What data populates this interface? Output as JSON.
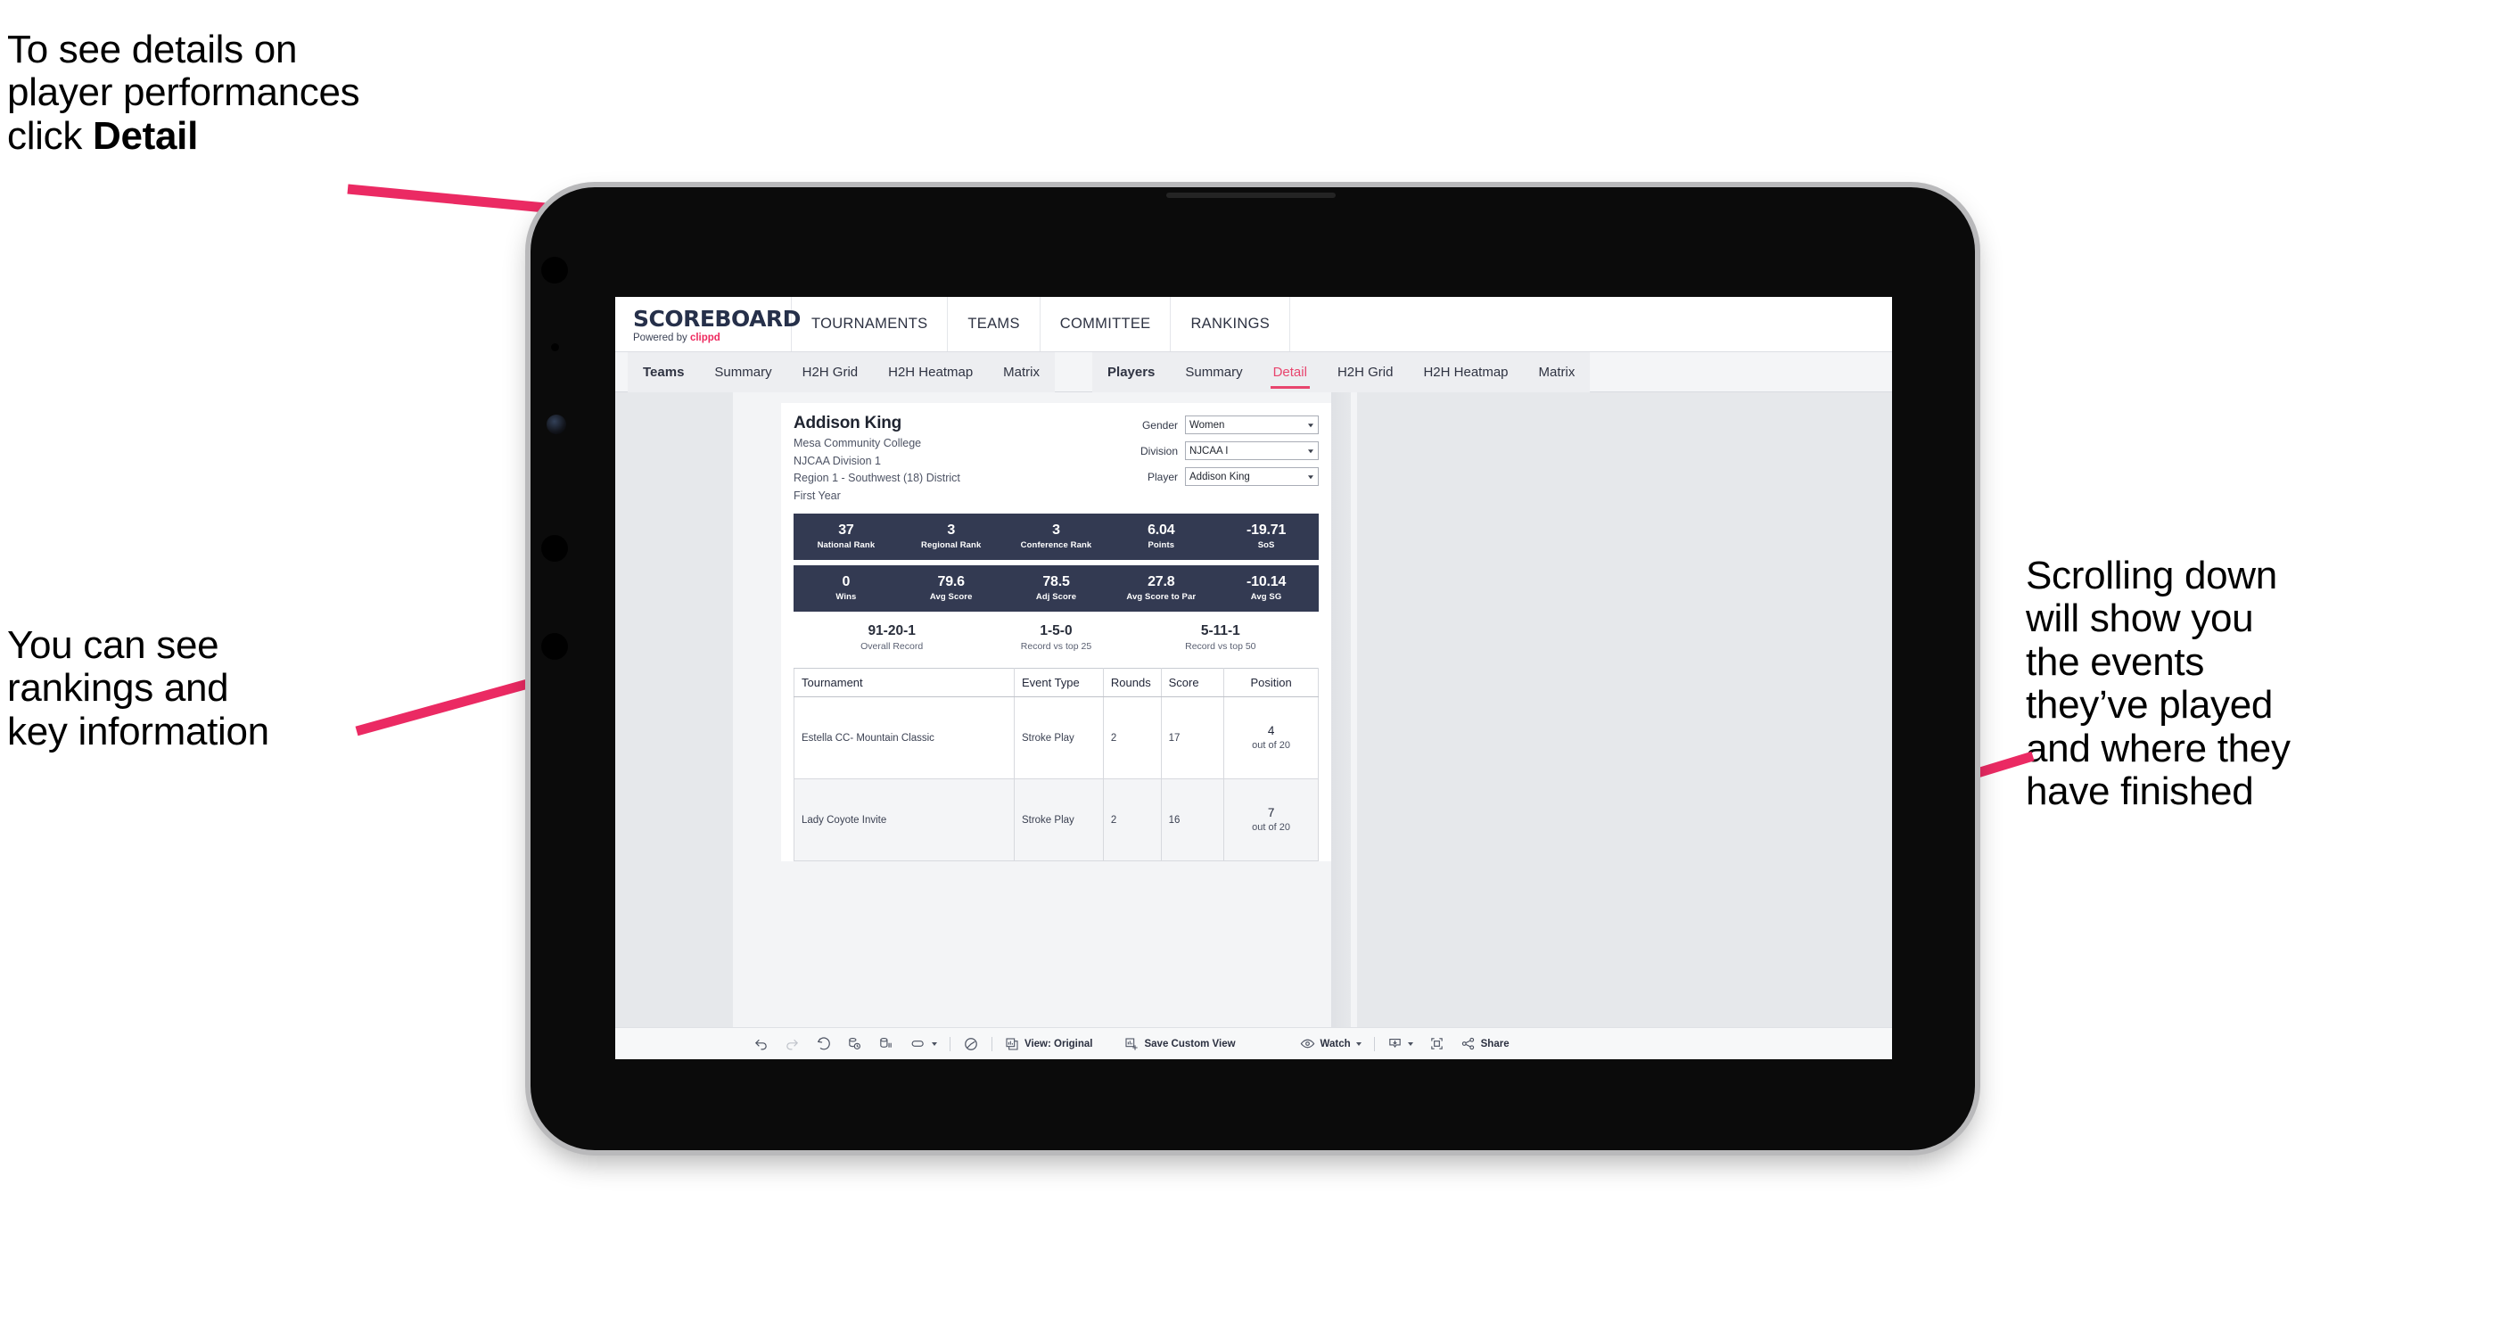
{
  "annotations": {
    "top_left": "To see details on\nplayer performances\nclick ",
    "top_left_bold": "Detail",
    "mid_left": "You can see\nrankings and\nkey information",
    "right": "Scrolling down\nwill show you\nthe events\nthey’ve played\nand where they\nhave finished"
  },
  "colors": {
    "accent_pink": "#e8456e",
    "arrow_pink": "#eb2a63",
    "kpi_navy": "#333a52"
  },
  "brand": {
    "logo_word": "SCOREBOARD",
    "logo_sub_prefix": "Powered by ",
    "logo_sub_brand": "clippd"
  },
  "top_nav": [
    {
      "label": "TOURNAMENTS"
    },
    {
      "label": "TEAMS"
    },
    {
      "label": "COMMITTEE"
    },
    {
      "label": "RANKINGS"
    }
  ],
  "tab_groups": [
    {
      "name": "teams-group",
      "tabs": [
        {
          "label": "Teams",
          "strong": true,
          "active": false
        },
        {
          "label": "Summary",
          "strong": false,
          "active": false
        },
        {
          "label": "H2H Grid",
          "strong": false,
          "active": false
        },
        {
          "label": "H2H Heatmap",
          "strong": false,
          "active": false
        },
        {
          "label": "Matrix",
          "strong": false,
          "active": false
        }
      ]
    },
    {
      "name": "players-group",
      "tabs": [
        {
          "label": "Players",
          "strong": true,
          "active": false
        },
        {
          "label": "Summary",
          "strong": false,
          "active": false
        },
        {
          "label": "Detail",
          "strong": false,
          "active": true
        },
        {
          "label": "H2H Grid",
          "strong": false,
          "active": false
        },
        {
          "label": "H2H Heatmap",
          "strong": false,
          "active": false
        },
        {
          "label": "Matrix",
          "strong": false,
          "active": false
        }
      ]
    }
  ],
  "player": {
    "name": "Addison King",
    "school": "Mesa Community College",
    "division": "NJCAA Division 1",
    "region": "Region 1 - Southwest (18) District",
    "class_year": "First Year"
  },
  "filters": [
    {
      "label": "Gender",
      "value": "Women"
    },
    {
      "label": "Division",
      "value": "NJCAA I"
    },
    {
      "label": "Player",
      "value": "Addison King"
    }
  ],
  "kpi_row_1": [
    {
      "value": "37",
      "label": "National Rank"
    },
    {
      "value": "3",
      "label": "Regional Rank"
    },
    {
      "value": "3",
      "label": "Conference Rank"
    },
    {
      "value": "6.04",
      "label": "Points"
    },
    {
      "value": "-19.71",
      "label": "SoS"
    }
  ],
  "kpi_row_2": [
    {
      "value": "0",
      "label": "Wins"
    },
    {
      "value": "79.6",
      "label": "Avg Score"
    },
    {
      "value": "78.5",
      "label": "Adj Score"
    },
    {
      "value": "27.8",
      "label": "Avg Score to Par"
    },
    {
      "value": "-10.14",
      "label": "Avg SG"
    }
  ],
  "records": [
    {
      "value": "91-20-1",
      "label": "Overall Record"
    },
    {
      "value": "1-5-0",
      "label": "Record vs top 25"
    },
    {
      "value": "5-11-1",
      "label": "Record vs top 50"
    }
  ],
  "events_table": {
    "columns": [
      "Tournament",
      "Event Type",
      "Rounds",
      "Score",
      "Position"
    ],
    "rows": [
      {
        "tournament": "Estella CC- Mountain Classic",
        "event_type": "Stroke Play",
        "rounds": "2",
        "score": "17",
        "position_num": "4",
        "position_out": "out of 20"
      },
      {
        "tournament": "Lady Coyote Invite",
        "event_type": "Stroke Play",
        "rounds": "2",
        "score": "16",
        "position_num": "7",
        "position_out": "out of 20"
      }
    ]
  },
  "toolbar": {
    "icons": [
      "undo-icon",
      "redo-icon",
      "revert-icon",
      "refresh-data-icon",
      "pause-updates-icon",
      "pill-icon",
      "pill-dropdown-icon",
      "presentation-icon"
    ],
    "view_original_label": "View: Original",
    "save_custom_view_label": "Save Custom View",
    "watch_label": "Watch",
    "share_label": "Share"
  }
}
